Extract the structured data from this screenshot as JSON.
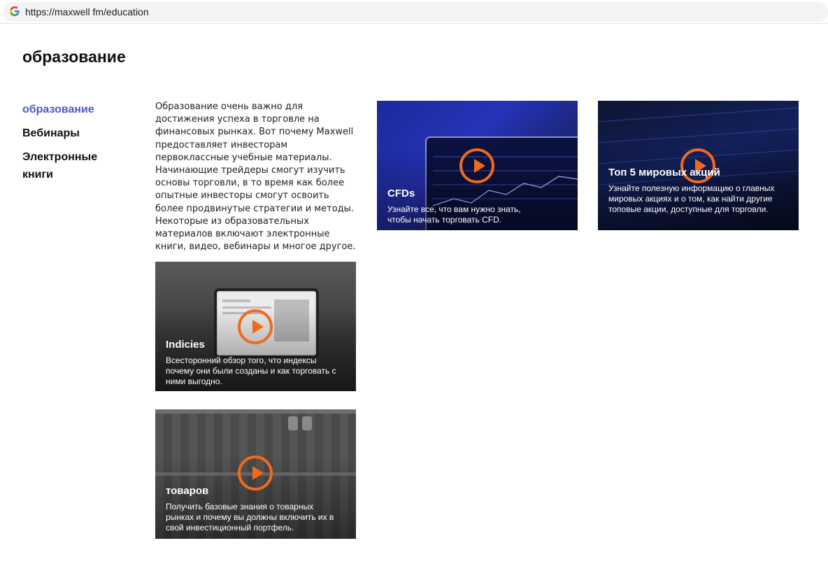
{
  "browser": {
    "url": "https://maxwell fm/education"
  },
  "page": {
    "title": "образование"
  },
  "sidebar": {
    "items": [
      {
        "label": "образование",
        "active": true
      },
      {
        "label": "Вебинары",
        "active": false
      },
      {
        "label": "Электронные книги",
        "active": false
      }
    ]
  },
  "intro": {
    "text": "Образование очень важно для достижения успеха в торговле на финансовых рынках. Вот почему Maxwell предоставляет инвесторам первоклассные учебные материалы. Начинающие трейдеры смогут изучить основы торговли, в то время как более опытные инвесторы смогут освоить более продвинутые стратегии и методы. Некоторые из образовательных материалов включают электронные книги, видео, вебинары и многое другое."
  },
  "cards": [
    {
      "title": "CFDs",
      "description": "Узнайте все, что вам нужно знать, чтобы начать торговать CFD.",
      "icon": "play-icon"
    },
    {
      "title": "Топ 5 мировых акций",
      "description": "Узнайте полезную информацию о главных мировых акциях и о том, как найти другие топовые акции, доступные для торговли.",
      "icon": "play-icon"
    },
    {
      "title": "Indicies",
      "description": "Всесторонний обзор того, что индексы почему они были созданы и как торговать с ними выгодно.",
      "icon": "play-icon"
    },
    {
      "title": "товаров",
      "description": "Получить базовые знания о товарных рынках и почему вы должны включить их в свой инвестиционный портфель.",
      "icon": "play-icon"
    }
  ],
  "colors": {
    "accent": "#f06a1e",
    "nav_active": "#4a5cc5"
  }
}
